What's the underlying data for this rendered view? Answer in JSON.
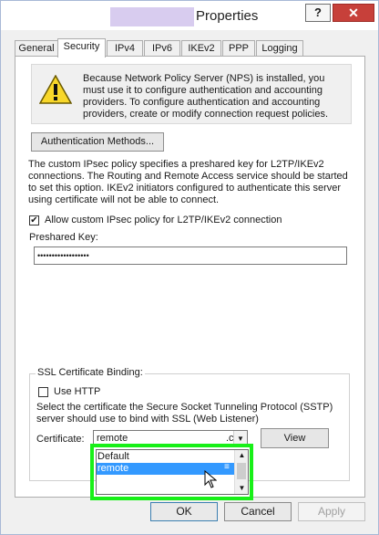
{
  "window": {
    "title": "Properties",
    "help_label": "?",
    "close_label": "✕"
  },
  "tabs": [
    {
      "label": "General"
    },
    {
      "label": "Security"
    },
    {
      "label": "IPv4"
    },
    {
      "label": "IPv6"
    },
    {
      "label": "IKEv2"
    },
    {
      "label": "PPP"
    },
    {
      "label": "Logging"
    }
  ],
  "active_tab": "Security",
  "warning": {
    "icon": "warning-icon",
    "text": "Because Network Policy Server (NPS) is installed, you must use it to configure authentication and accounting providers. To configure authentication and accounting providers, create or modify connection request policies."
  },
  "auth_methods_button": "Authentication Methods...",
  "ipsec_description": "The custom IPsec policy specifies a preshared key for L2TP/IKEv2 connections. The Routing and Remote Access service should be started to set this option. IKEv2 initiators configured to authenticate this server using certificate will not be able to connect.",
  "allow_ipsec": {
    "label": "Allow custom IPsec policy for L2TP/IKEv2 connection",
    "checked": true
  },
  "preshared_key": {
    "label": "Preshared Key:",
    "value": "••••••••••••••••••"
  },
  "ssl_binding": {
    "legend": "SSL Certificate Binding:",
    "use_http": {
      "label": "Use HTTP",
      "checked": false
    },
    "description": "Select the certificate the Secure Socket Tunneling Protocol (SSTP) server should use to bind with SSL (Web Listener)",
    "certificate_label": "Certificate:",
    "certificate_value": "remote",
    "certificate_suffix": ".c",
    "view_button": "View",
    "options": [
      "Default",
      "remote"
    ],
    "selected_option": "remote",
    "scroll_mark": "≡"
  },
  "footer": {
    "ok": "OK",
    "cancel": "Cancel",
    "apply": "Apply"
  },
  "colors": {
    "selection": "#3399ff",
    "highlight": "#18f018",
    "close": "#c7403a"
  }
}
